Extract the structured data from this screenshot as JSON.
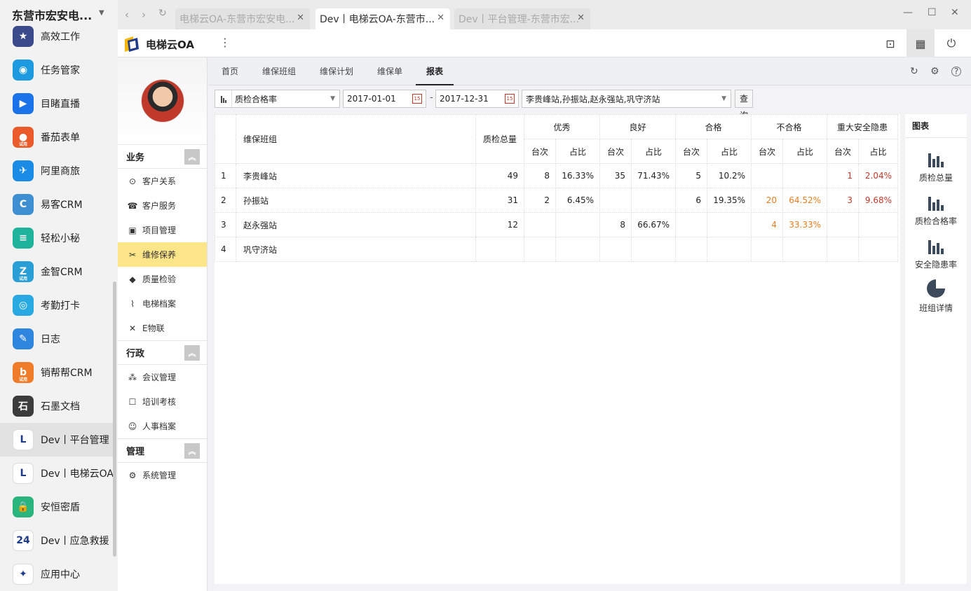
{
  "launcher": {
    "org": "东营市宏安电...",
    "apps": [
      {
        "label": "高效工作",
        "color": "#3b4a8a",
        "glyph": "★"
      },
      {
        "label": "任务管家",
        "color": "#1e9be0",
        "glyph": "◉"
      },
      {
        "label": "目睹直播",
        "color": "#1a73e8",
        "glyph": "▶"
      },
      {
        "label": "番茄表单",
        "color": "#ea5a2a",
        "glyph": "●"
      },
      {
        "label": "阿里商旅",
        "color": "#1a8ce6",
        "glyph": "✈"
      },
      {
        "label": "易客CRM",
        "color": "#3d8fd1",
        "glyph": "C"
      },
      {
        "label": "轻松小秘",
        "color": "#20b39b",
        "glyph": "≡"
      },
      {
        "label": "金智CRM",
        "color": "#2a9fd6",
        "glyph": "Z"
      },
      {
        "label": "考勤打卡",
        "color": "#29a9e1",
        "glyph": "◎"
      },
      {
        "label": "日志",
        "color": "#2e86de",
        "glyph": "✎"
      },
      {
        "label": "销帮帮CRM",
        "color": "#f07c2a",
        "glyph": "b"
      },
      {
        "label": "石墨文档",
        "color": "#3c3c3c",
        "glyph": "石"
      },
      {
        "label": "Dev丨平台管理",
        "color": "#ffffff",
        "glyph": "L"
      },
      {
        "label": "Dev丨电梯云OA",
        "color": "#ffffff",
        "glyph": "L"
      },
      {
        "label": "安恒密盾",
        "color": "#2ab57d",
        "glyph": "🔒"
      },
      {
        "label": "Dev丨应急救援",
        "color": "#ffffff",
        "glyph": "24"
      },
      {
        "label": "应用中心",
        "color": "#ffffff",
        "glyph": "✦"
      }
    ],
    "tag": "试用"
  },
  "browser": {
    "tabs": [
      "电梯云OA-东营市宏安电...",
      "Dev丨电梯云OA-东营市...",
      "Dev丨平台管理-东营市宏..."
    ]
  },
  "header": {
    "brand": "电梯云OA"
  },
  "sidebar": {
    "sections": [
      {
        "title": "业务",
        "items": [
          {
            "label": "客户关系",
            "icon": "crm-icon",
            "glyph": "⊙"
          },
          {
            "label": "客户服务",
            "icon": "headset-icon",
            "glyph": "☎"
          },
          {
            "label": "项目管理",
            "icon": "project-icon",
            "glyph": "▣"
          },
          {
            "label": "维修保养",
            "icon": "tools-icon",
            "glyph": "✂"
          },
          {
            "label": "质量检验",
            "icon": "shield-icon",
            "glyph": "◆"
          },
          {
            "label": "电梯档案",
            "icon": "elevator-icon",
            "glyph": "⌇"
          },
          {
            "label": "E物联",
            "icon": "iot-icon",
            "glyph": "✕"
          }
        ]
      },
      {
        "title": "行政",
        "items": [
          {
            "label": "会议管理",
            "icon": "meeting-icon",
            "glyph": "⁂"
          },
          {
            "label": "培训考核",
            "icon": "training-icon",
            "glyph": "☐"
          },
          {
            "label": "人事档案",
            "icon": "hr-icon",
            "glyph": "☺"
          }
        ]
      },
      {
        "title": "管理",
        "items": [
          {
            "label": "系统管理",
            "icon": "settings-icon",
            "glyph": "⚙"
          }
        ]
      }
    ]
  },
  "main": {
    "tabs": [
      "首页",
      "维保班组",
      "维保计划",
      "维保单",
      "报表"
    ],
    "filter": {
      "report": "质检合格率",
      "start": "2017-01-01",
      "end": "2017-12-31",
      "stations": "李贵峰站,孙振站,赵永强站,巩守济站",
      "query": "查询",
      "cal": "15"
    },
    "table": {
      "col_team": "维保班组",
      "col_total": "质检总量",
      "groups": [
        "优秀",
        "良好",
        "合格",
        "不合格",
        "重大安全隐患"
      ],
      "sub": [
        "台次",
        "占比"
      ],
      "rows": [
        {
          "no": "1",
          "team": "李贵峰站",
          "total": "49",
          "v": [
            "8",
            "16.33%",
            "35",
            "71.43%",
            "5",
            "10.2%",
            "",
            "",
            "1",
            "2.04%"
          ]
        },
        {
          "no": "2",
          "team": "孙振站",
          "total": "31",
          "v": [
            "2",
            "6.45%",
            "",
            "",
            "6",
            "19.35%",
            "20",
            "64.52%",
            "3",
            "9.68%"
          ]
        },
        {
          "no": "3",
          "team": "赵永强站",
          "total": "12",
          "v": [
            "",
            "",
            "8",
            "66.67%",
            "",
            "",
            "4",
            "33.33%",
            "",
            ""
          ]
        },
        {
          "no": "4",
          "team": "巩守济站",
          "total": "",
          "v": [
            "",
            "",
            "",
            "",
            "",
            "",
            "",
            "",
            "",
            ""
          ]
        }
      ]
    },
    "charts": {
      "title": "图表",
      "items": [
        "质检总量",
        "质检合格率",
        "安全隐患率",
        "班组详情"
      ]
    }
  }
}
